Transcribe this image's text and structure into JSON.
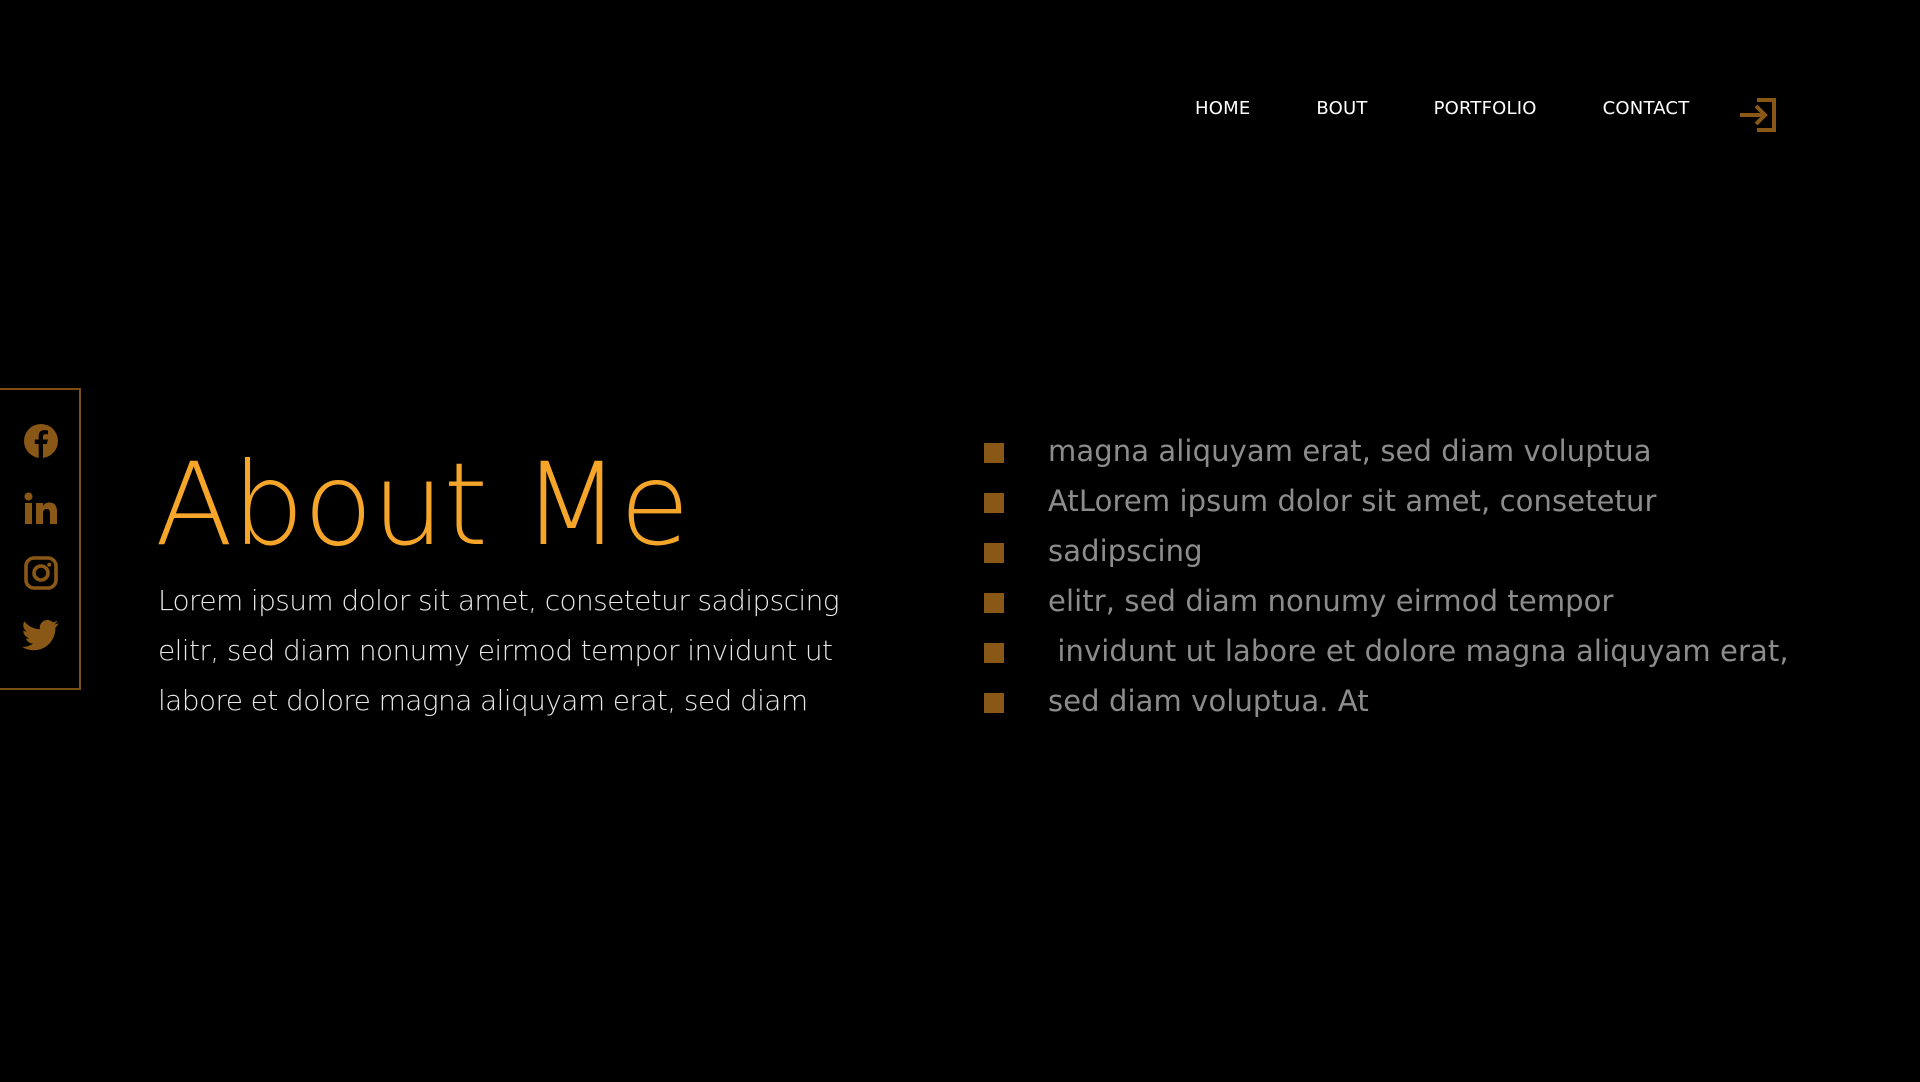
{
  "nav": {
    "items": [
      {
        "label": "HOME"
      },
      {
        "label": "BOUT"
      },
      {
        "label": "PORTFOLIO"
      },
      {
        "label": "CONTACT"
      }
    ],
    "login_icon": "login-arrow-icon"
  },
  "social": {
    "icons": [
      "facebook-icon",
      "linkedin-icon",
      "instagram-icon",
      "twitter-icon"
    ]
  },
  "about": {
    "title": "About Me",
    "body": "Lorem ipsum dolor sit amet, consetetur sadipscing elitr, sed diam nonumy eirmod tempor invidunt ut labore et dolore magna aliquyam erat, sed diam"
  },
  "features": {
    "items": [
      {
        "text": "magna aliquyam erat, sed diam voluptua"
      },
      {
        "text": "AtLorem ipsum dolor sit amet, consetetur"
      },
      {
        "text": "sadipscing"
      },
      {
        "text": "elitr, sed diam nonumy eirmod tempor"
      },
      {
        "text": " invidunt ut labore et dolore magna aliquyam erat,"
      },
      {
        "text": "sed diam voluptua. At"
      }
    ]
  },
  "colors": {
    "background": "#000000",
    "accent": "#f5a52a",
    "accent_dark": "#8a5816",
    "nav_text": "#ffffff",
    "body_text": "#e8e8e8",
    "feature_text": "#8c8c8c"
  }
}
